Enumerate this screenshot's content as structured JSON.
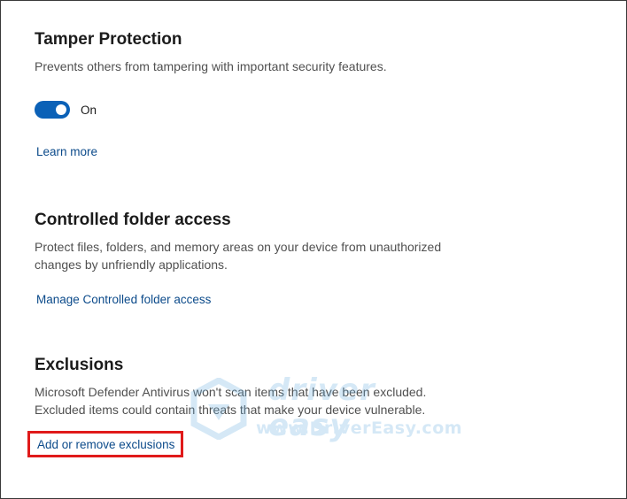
{
  "tamper_protection": {
    "title": "Tamper Protection",
    "description": "Prevents others from tampering with important security features.",
    "toggle_state": "On",
    "learn_more": "Learn more"
  },
  "controlled_folder_access": {
    "title": "Controlled folder access",
    "description_line1": "Protect files, folders, and memory areas on your device from unauthorized",
    "description_line2": "changes by unfriendly applications.",
    "link": "Manage Controlled folder access"
  },
  "exclusions": {
    "title": "Exclusions",
    "description_line1": "Microsoft Defender Antivirus won't scan items that have been excluded.",
    "description_line2": "Excluded items could contain threats that make your device vulnerable.",
    "link": "Add or remove exclusions"
  },
  "watermark": {
    "name": "driver easy",
    "url": "www.DriverEasy.com"
  },
  "colors": {
    "accent": "#0b61b7",
    "link": "#0b4a8a",
    "highlight_box": "#e01a1a"
  }
}
